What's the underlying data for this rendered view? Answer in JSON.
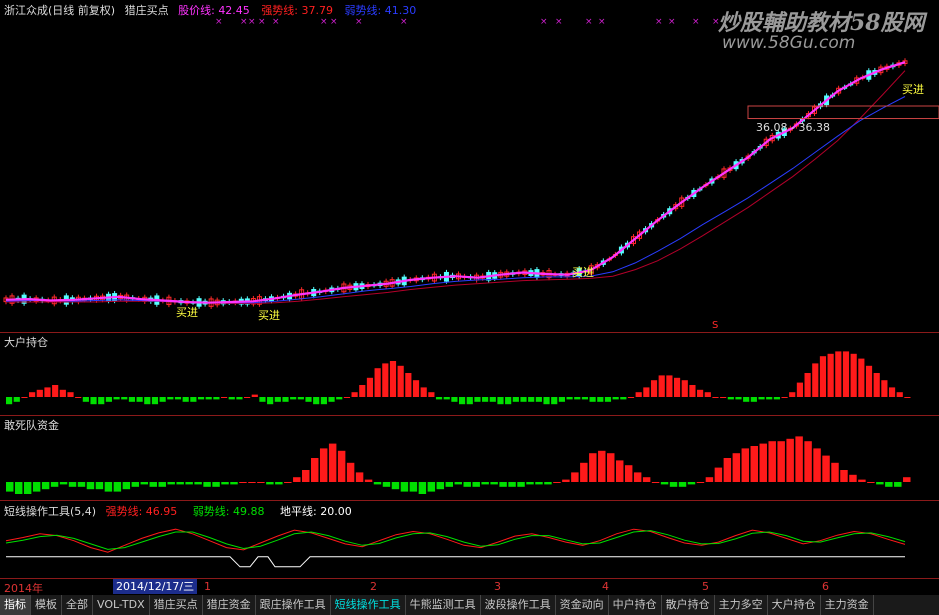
{
  "main_header": {
    "stock": "浙江众成(日线 前复权)",
    "indicator": "猎庄买点",
    "l1_label": "股价线:",
    "l1_value": "42.45",
    "l2_label": "强势线:",
    "l2_value": "37.79",
    "l3_label": "弱势线:",
    "l3_value": "41.30"
  },
  "watermark": {
    "line1": "炒股輔助教材58股网",
    "line2": "www.58Gu.com"
  },
  "price_annotation": "36.08 - 36.38",
  "buy_label": "买进",
  "marker_s": "S",
  "panel2_title": "大户持仓",
  "panel3_title": "敢死队资金",
  "panel4_header": {
    "title": "短线操作工具(5,4)",
    "l1_label": "强势线:",
    "l1_value": "46.95",
    "l2_label": "弱势线:",
    "l2_value": "49.88",
    "l3_label": "地平线:",
    "l3_value": "20.00"
  },
  "date_axis": {
    "year": "2014年",
    "date_box": "2014/12/17/三",
    "months": [
      "1",
      "2",
      "3",
      "4",
      "5",
      "6"
    ]
  },
  "tabs": [
    "指标",
    "模板",
    "全部",
    "VOL-TDX",
    "猎庄买点",
    "猎庄资金",
    "跟庄操作工具",
    "短线操作工具",
    "牛熊监测工具",
    "波段操作工具",
    "资金动向",
    "中户持仓",
    "散户持仓",
    "主力多空",
    "大户持仓",
    "主力资金"
  ],
  "colors": {
    "up": "#ff2a2a",
    "down": "#54ffff",
    "ma_fast": "#ff33ff",
    "ma_mid": "#2a3cff",
    "ma_slow": "#b3002a",
    "green": "#00e000",
    "red": "#ff1a1a"
  },
  "chart_data": [
    {
      "type": "line",
      "title": "猎庄买点",
      "series": [
        {
          "name": "股价线",
          "values": [
            10.2,
            10.3,
            10.1,
            10.2,
            10.4,
            10.6,
            10.3,
            10.1,
            9.9,
            9.8,
            9.9,
            10.0,
            10.4,
            10.9,
            11.3,
            11.8,
            12.1,
            12.4,
            12.9,
            13.2,
            13.4,
            13.2,
            13.6,
            13.9,
            13.7,
            13.6,
            14.2,
            16.0,
            18.5,
            21.0,
            23.3,
            25.5,
            27.5,
            29.5,
            32.0,
            33.5,
            36.0,
            38.5,
            40.2,
            41.5,
            42.45
          ]
        },
        {
          "name": "强势线",
          "values": [
            10.0,
            10.1,
            10.1,
            10.0,
            10.1,
            10.2,
            10.1,
            10.0,
            9.9,
            9.8,
            9.8,
            9.8,
            10.0,
            10.3,
            10.6,
            11.0,
            11.4,
            11.7,
            12.0,
            12.4,
            12.7,
            12.9,
            13.0,
            13.2,
            13.3,
            13.3,
            13.4,
            14.0,
            15.2,
            16.8,
            18.5,
            20.4,
            22.2,
            24.0,
            26.0,
            28.0,
            30.2,
            32.4,
            34.5,
            36.2,
            37.79
          ]
        },
        {
          "name": "弱势线",
          "values": [
            9.9,
            9.9,
            9.9,
            9.9,
            9.9,
            10.0,
            10.0,
            10.0,
            9.9,
            9.8,
            9.7,
            9.7,
            9.8,
            10.0,
            10.3,
            10.6,
            10.9,
            11.2,
            11.6,
            11.9,
            12.2,
            12.4,
            12.6,
            12.8,
            12.9,
            13.0,
            13.1,
            13.4,
            14.3,
            15.5,
            17.1,
            18.9,
            20.8,
            22.7,
            24.8,
            26.9,
            29.3,
            31.8,
            34.8,
            38.0,
            41.3
          ]
        }
      ],
      "x": [
        0,
        1,
        2,
        3,
        4,
        5,
        6,
        7,
        8,
        9,
        10,
        11,
        12,
        13,
        14,
        15,
        16,
        17,
        18,
        19,
        20,
        21,
        22,
        23,
        24,
        25,
        26,
        27,
        28,
        29,
        30,
        31,
        32,
        33,
        34,
        35,
        36,
        37,
        38,
        39,
        40
      ],
      "ylim": [
        8,
        46
      ]
    },
    {
      "type": "bar",
      "title": "大户持仓",
      "values": [
        -3,
        -2,
        0,
        2,
        3,
        4,
        5,
        3,
        2,
        0,
        -2,
        -3,
        -3,
        -2,
        -1,
        -1,
        -2,
        -2,
        -3,
        -3,
        -2,
        -1,
        -1,
        -2,
        -2,
        -1,
        -1,
        -1,
        0,
        -1,
        -1,
        0,
        1,
        -2,
        -3,
        -2,
        -2,
        -1,
        -1,
        -2,
        -3,
        -3,
        -2,
        -1,
        0,
        2,
        5,
        8,
        12,
        14,
        15,
        13,
        10,
        7,
        4,
        2,
        -1,
        -1,
        -2,
        -3,
        -3,
        -2,
        -2,
        -2,
        -3,
        -3,
        -2,
        -2,
        -2,
        -2,
        -3,
        -3,
        -2,
        -1,
        -1,
        -1,
        -2,
        -2,
        -2,
        -1,
        -1,
        0,
        2,
        4,
        7,
        9,
        9,
        8,
        7,
        5,
        3,
        2,
        0,
        0,
        -1,
        -1,
        -2,
        -2,
        -1,
        -1,
        -1,
        0,
        2,
        6,
        10,
        14,
        17,
        18,
        19,
        19,
        18,
        16,
        13,
        10,
        7,
        4,
        2,
        0
      ]
    },
    {
      "type": "bar",
      "title": "敢死队资金",
      "values": [
        -4,
        -5,
        -5,
        -4,
        -3,
        -2,
        -1,
        -2,
        -2,
        -3,
        -3,
        -4,
        -4,
        -3,
        -2,
        -1,
        -2,
        -2,
        -1,
        -1,
        -1,
        -1,
        -2,
        -2,
        -1,
        -1,
        0,
        0,
        0,
        -1,
        -1,
        0,
        2,
        5,
        10,
        14,
        16,
        13,
        8,
        4,
        1,
        -1,
        -2,
        -3,
        -4,
        -4,
        -5,
        -4,
        -3,
        -2,
        -1,
        -2,
        -2,
        -1,
        -1,
        -2,
        -2,
        -2,
        -1,
        -1,
        -1,
        0,
        1,
        4,
        8,
        12,
        13,
        12,
        9,
        7,
        4,
        2,
        0,
        -1,
        -2,
        -2,
        -1,
        0,
        2,
        6,
        10,
        12,
        14,
        15,
        16,
        17,
        17,
        18,
        19,
        17,
        14,
        11,
        8,
        5,
        3,
        1,
        0,
        -1,
        -2,
        -2,
        2
      ]
    },
    {
      "type": "line",
      "title": "短线操作工具(5,4)",
      "series": [
        {
          "name": "强势线",
          "values": [
            55,
            62,
            70,
            66,
            55,
            40,
            30,
            45,
            60,
            72,
            80,
            70,
            55,
            40,
            35,
            50,
            65,
            78,
            72,
            60,
            48,
            42,
            55,
            68,
            75,
            70,
            58,
            45,
            40,
            52,
            65,
            70,
            62,
            52,
            45,
            55,
            70,
            80,
            75,
            62,
            50,
            45,
            52,
            66,
            78,
            72,
            60,
            48,
            55,
            67,
            75,
            70,
            58,
            47
          ]
        },
        {
          "name": "弱势线",
          "values": [
            50,
            56,
            64,
            67,
            60,
            48,
            36,
            40,
            52,
            64,
            74,
            74,
            62,
            48,
            38,
            43,
            56,
            70,
            74,
            66,
            54,
            45,
            49,
            61,
            70,
            72,
            64,
            52,
            43,
            46,
            58,
            66,
            66,
            57,
            48,
            50,
            62,
            74,
            77,
            68,
            56,
            48,
            49,
            59,
            71,
            74,
            66,
            54,
            52,
            61,
            70,
            72,
            64,
            53
          ]
        }
      ],
      "ylim": [
        0,
        100
      ]
    }
  ]
}
